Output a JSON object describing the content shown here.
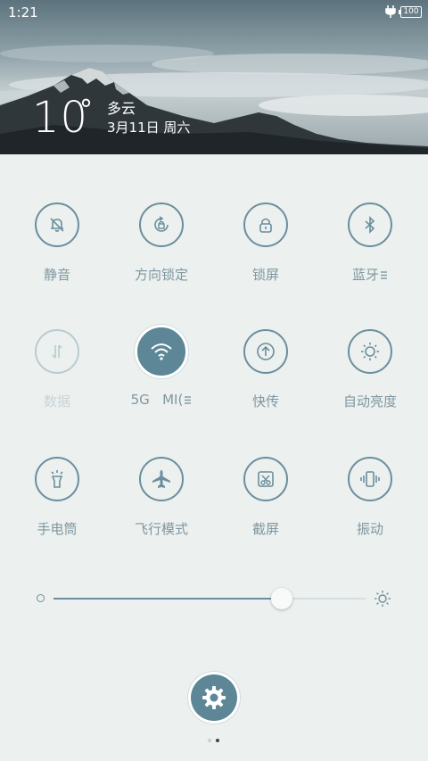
{
  "status": {
    "time": "1:21",
    "battery": "100"
  },
  "weather": {
    "temperature": "10",
    "degree": "°",
    "condition": "多云",
    "date": "3月11日 周六"
  },
  "toggles": [
    {
      "label": "静音",
      "icon": "bell-off-icon"
    },
    {
      "label": "方向锁定",
      "icon": "rotation-lock-icon"
    },
    {
      "label": "锁屏",
      "icon": "lock-icon"
    },
    {
      "label": "蓝牙",
      "icon": "bluetooth-icon"
    },
    {
      "label": "数据",
      "icon": "data-arrows-icon"
    },
    {
      "label": "5G   MI(",
      "icon": "wifi-icon"
    },
    {
      "label": "快传",
      "icon": "upload-arrow-icon"
    },
    {
      "label": "自动亮度",
      "icon": "sun-icon"
    },
    {
      "label": "手电筒",
      "icon": "flashlight-icon"
    },
    {
      "label": "飞行模式",
      "icon": "airplane-icon"
    },
    {
      "label": "截屏",
      "icon": "screenshot-icon"
    },
    {
      "label": "振动",
      "icon": "vibrate-icon"
    }
  ],
  "brightness": {
    "level": 0.73
  },
  "pagination": {
    "current": 2,
    "total": 2
  },
  "colors": {
    "accent": "#5d8797",
    "outline": "#6b8e9e",
    "label": "#7f97a1",
    "background": "#ecf0ee"
  }
}
